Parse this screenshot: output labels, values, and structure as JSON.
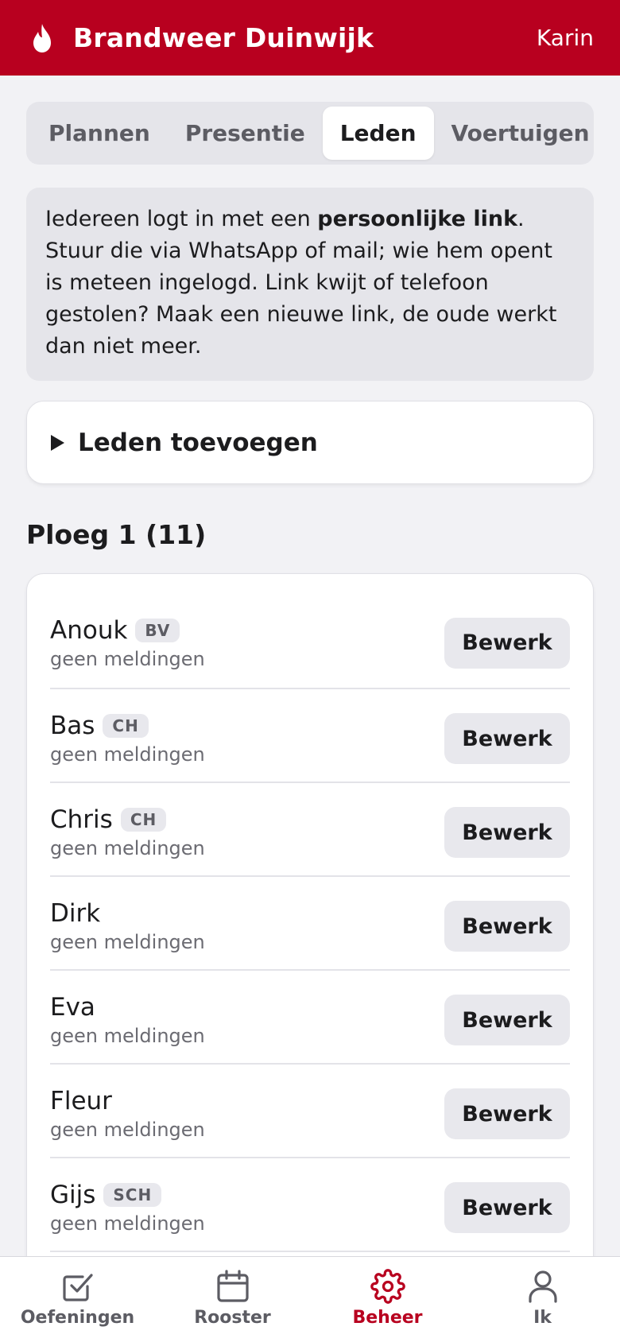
{
  "app": {
    "title": "Brandweer Duinwijk",
    "user": "Karin",
    "accent_color": "#b8001f",
    "logo_icon": "flame-icon"
  },
  "tabs": [
    {
      "label": "Plannen",
      "active": false
    },
    {
      "label": "Presentie",
      "active": false
    },
    {
      "label": "Leden",
      "active": true
    },
    {
      "label": "Voertuigen",
      "active": false
    }
  ],
  "info": {
    "text_before": "Iedereen logt in met een ",
    "bold": "persoonlijke link",
    "text_after": ". Stuur die via WhatsApp of mail; wie hem opent is meteen ingelogd. Link kwijt of telefoon gestolen? Maak een nieuwe link, de oude werkt dan niet meer."
  },
  "add_members": {
    "label": "Leden toevoegen",
    "icon": "disclosure-triangle-icon"
  },
  "group": {
    "title": "Ploeg 1 (11)",
    "members": [
      {
        "name": "Anouk",
        "badge": "BV",
        "status": "geen meldingen",
        "button": "Bewerk"
      },
      {
        "name": "Bas",
        "badge": "CH",
        "status": "geen meldingen",
        "button": "Bewerk"
      },
      {
        "name": "Chris",
        "badge": "CH",
        "status": "geen meldingen",
        "button": "Bewerk"
      },
      {
        "name": "Dirk",
        "badge": "",
        "status": "geen meldingen",
        "button": "Bewerk"
      },
      {
        "name": "Eva",
        "badge": "",
        "status": "geen meldingen",
        "button": "Bewerk"
      },
      {
        "name": "Fleur",
        "badge": "",
        "status": "geen meldingen",
        "button": "Bewerk"
      },
      {
        "name": "Gijs",
        "badge": "SCH",
        "status": "geen meldingen",
        "button": "Bewerk"
      }
    ]
  },
  "bottom_nav": [
    {
      "label": "Oefeningen",
      "icon": "checkbox-icon",
      "active": false
    },
    {
      "label": "Rooster",
      "icon": "calendar-icon",
      "active": false
    },
    {
      "label": "Beheer",
      "icon": "gear-icon",
      "active": true
    },
    {
      "label": "Ik",
      "icon": "user-icon",
      "active": false
    }
  ]
}
